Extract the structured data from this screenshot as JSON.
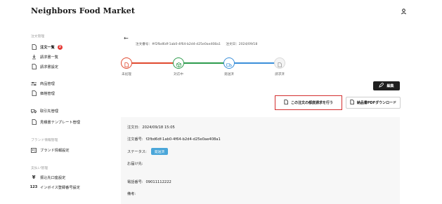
{
  "app": {
    "title": "Neighbors Food Market"
  },
  "sidebar": {
    "sections": [
      {
        "label": "注文管理",
        "items": [
          {
            "label": "注文一覧",
            "icon": "document-icon",
            "active": true,
            "badge": "2"
          },
          {
            "label": "請求書一覧",
            "icon": "download-icon"
          },
          {
            "label": "請求書設定",
            "icon": "document-icon"
          }
        ]
      },
      {
        "label": "",
        "items": [
          {
            "label": "商品管理",
            "icon": "sliders-icon"
          },
          {
            "label": "価格管理",
            "icon": "document-icon"
          }
        ]
      },
      {
        "label": "",
        "items": [
          {
            "label": "取引先管理",
            "icon": "truck-icon"
          },
          {
            "label": "見積書テンプレート管理",
            "icon": "document-icon"
          }
        ]
      },
      {
        "label": "ブランド情報管理",
        "items": [
          {
            "label": "ブランド情報設定",
            "icon": "id-card-icon"
          }
        ]
      },
      {
        "label": "支払い管理",
        "items": [
          {
            "label": "振込先口座設定",
            "icon": "yen-icon"
          },
          {
            "label": "インボイス登録番号設定",
            "icon": "numbers-icon"
          }
        ]
      }
    ]
  },
  "order": {
    "number_label": "注文番号：#f2fbd6df-1ab0-4f64-b2d4-d25e0ae408a1",
    "date_label": "注文日：2024/09/18"
  },
  "steps": [
    {
      "label": "未処理",
      "color": "#e0492f",
      "icon": "document-icon"
    },
    {
      "label": "対応中",
      "color": "#2e9b4d",
      "icon": "box-icon"
    },
    {
      "label": "発送済",
      "color": "#3a8fd9",
      "icon": "truck-icon"
    },
    {
      "label": "請求済",
      "color": "#bdbdbd",
      "icon": "document-icon"
    }
  ],
  "actions": {
    "edit_label": "編集",
    "request_label": "この注文の都度請求を行う",
    "pdf_label": "納品書PDFダウンロード"
  },
  "details": {
    "order_date_key": "注文日:",
    "order_date_value": "2024/09/18 15:05",
    "order_no_key": "注文番号:",
    "order_no_value": "f2fbd6df-1ab0-4f64-b2d4-d25e0ae408a1",
    "status_key": "ステータス:",
    "status_value": "発送済",
    "ship_to_key": "お届け先:",
    "phone_key": "電話番号:",
    "phone_value": "09011112222",
    "note_key": "備考:"
  },
  "colors": {
    "accent_red": "#d32f2f",
    "status_blue": "#4aa6d9",
    "dark": "#1f1f1f"
  }
}
